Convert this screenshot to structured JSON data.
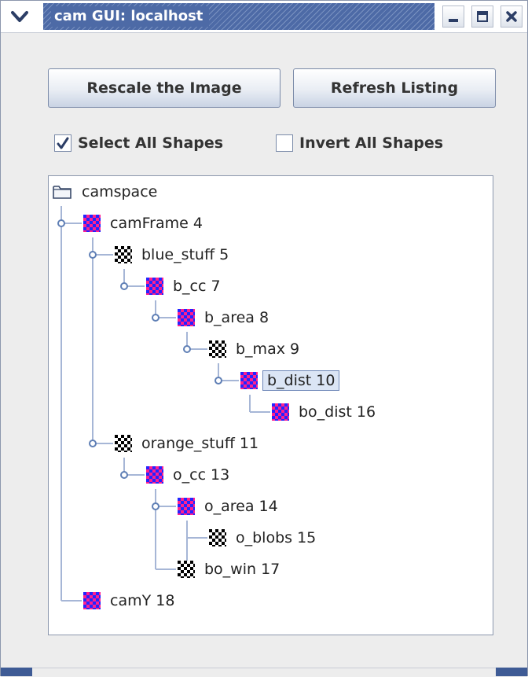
{
  "window": {
    "title": "cam GUI: localhost"
  },
  "buttons": {
    "rescale_label": "Rescale the Image",
    "refresh_label": "Refresh Listing"
  },
  "checkboxes": {
    "select_all_label": "Select All Shapes",
    "select_all_checked": true,
    "invert_all_label": "Invert All Shapes",
    "invert_all_checked": false
  },
  "colors": {
    "title_bar": "#4d6aa6",
    "pattern_magenta": "#ff1f8f",
    "pattern_blue": "#2424ff",
    "pattern_black": "#000000",
    "tree_line": "#a6b6d6",
    "selection": "#dbe5f5"
  },
  "tree": {
    "root": {
      "label": "camspace",
      "icon": "folder-icon"
    },
    "nodes": [
      {
        "label": "camFrame 4",
        "icon": "magenta-blue-pattern-icon",
        "selected": false
      },
      {
        "label": "blue_stuff 5",
        "icon": "black-white-pattern-icon",
        "selected": false
      },
      {
        "label": "b_cc 7",
        "icon": "magenta-blue-pattern-icon",
        "selected": false
      },
      {
        "label": "b_area 8",
        "icon": "magenta-blue-pattern-icon",
        "selected": false
      },
      {
        "label": "b_max 9",
        "icon": "black-white-pattern-icon",
        "selected": false
      },
      {
        "label": "b_dist 10",
        "icon": "magenta-blue-pattern-icon",
        "selected": true
      },
      {
        "label": "bo_dist 16",
        "icon": "magenta-blue-pattern-icon",
        "selected": false
      },
      {
        "label": "orange_stuff 11",
        "icon": "black-white-pattern-icon",
        "selected": false
      },
      {
        "label": "o_cc 13",
        "icon": "magenta-blue-pattern-icon",
        "selected": false
      },
      {
        "label": "o_area 14",
        "icon": "magenta-blue-pattern-icon",
        "selected": false
      },
      {
        "label": "o_blobs 15",
        "icon": "black-white-pattern-icon",
        "selected": false
      },
      {
        "label": "bo_win 17",
        "icon": "black-white-pattern-icon",
        "selected": false
      },
      {
        "label": "camY 18",
        "icon": "magenta-blue-pattern-icon",
        "selected": false
      }
    ]
  }
}
